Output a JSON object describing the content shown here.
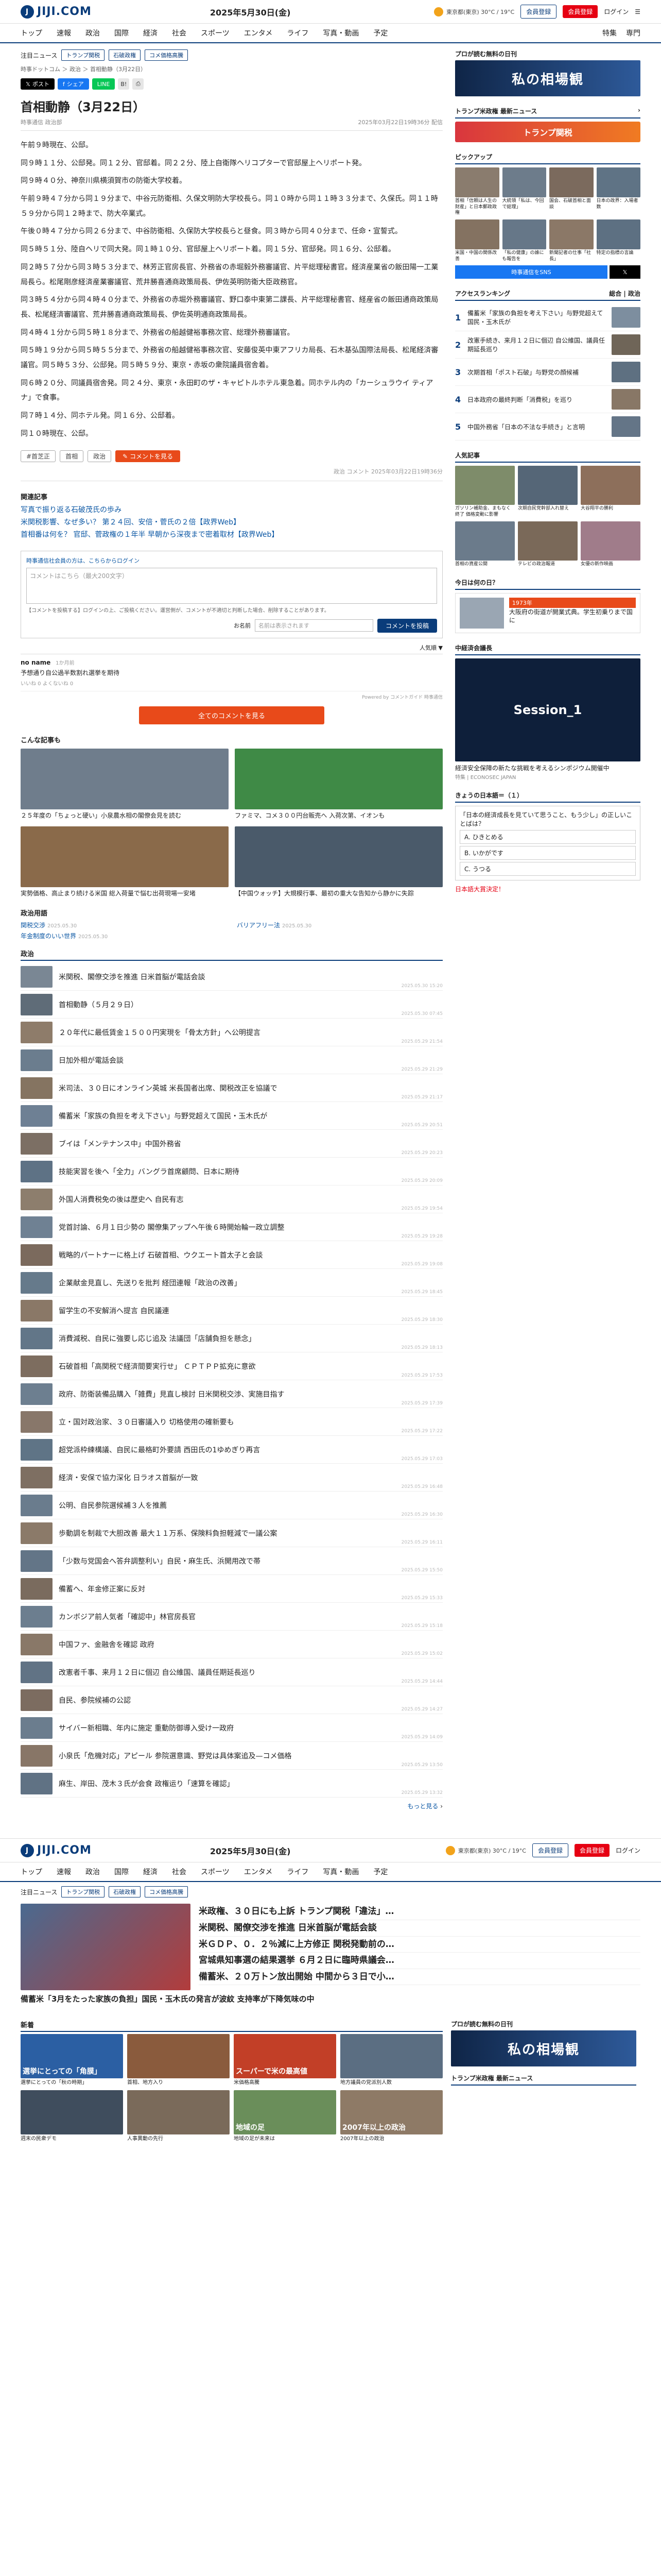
{
  "header": {
    "logo": "JIJI.COM",
    "date": "2025年5月30日(金)",
    "weather_text": "東京都(東京) 30°C / 19°C",
    "free_register": "会員登録",
    "member_register": "会員登録",
    "login": "ログイン",
    "nav": [
      "トップ",
      "速報",
      "政治",
      "国際",
      "経済",
      "社会",
      "スポーツ",
      "エンタメ",
      "ライフ",
      "写真・動画",
      "予定",
      "特集",
      "専門"
    ]
  },
  "breadcrumb": {
    "prefix": "注目ニュース",
    "chips": [
      "トランプ関税",
      "石破政権",
      "コメ価格高騰"
    ],
    "path": "時事ドットコム ＞ 政治 ＞ 首相動静（3月22日）"
  },
  "share": {
    "x": "ポスト",
    "facebook": "シェア",
    "line": "LINE"
  },
  "article": {
    "title": "首相動静（3月22日）",
    "source": "時事通信 政治部",
    "published": "2025年03月22日19時36分 配信",
    "paragraphs": [
      "午前９時現在、公邸。",
      "同９時１１分、公邸発。同１２分、官邸着。同２２分、陸上自衛隊ヘリコプターで官邸屋上ヘリポート発。",
      "同９時４０分、神奈川県横須賀市の防衛大学校着。",
      "午前９時４７分から同１９分まで、中谷元防衛相、久保文明防大学校長ら。同１０時から同１１時３３分まで、久保氏。同１１時５９分から同１２時まで、防大卒業式。",
      "午後０時４７分から同２６分まで、中谷防衛相、久保防大学校長らと昼食。同３時から同４０分まで、任命・宣誓式。",
      "同５時５１分、陸自ヘリで同大発。同１時１０分、官邸屋上ヘリポート着。同１５分、官邸発。同１６分、公邸着。",
      "同２時５７分から同３時５３分まで、林芳正官房長官、外務省の赤堀毅外務審議官、片平総理秘書官。経済産業省の飯田陽一工業局長ら。松尾剛彦経済産業審議官、荒井勝喜通商政策局長、伊佐英明防衛大臣政務官。",
      "同３時５４分から同４時４０分まで、外務省の赤堀外務審議官、野口泰中東第二課長、片平総理秘書官、経産省の飯田通商政策局長、松尾経済審議官、荒井勝喜通商政策局長、伊佐英明通商政策局長。",
      "同４時４１分から同５時１８分まで、外務省の船越健裕事務次官、総理外務審議官。",
      "同５時１９分から同５時５５分まで、外務省の船越健裕事務次官、安藤俊英中東アフリカ局長、石木基弘国際法局長、松尾経済審議官。同５時５３分、公邸発。同５時５９分、東京・赤坂の衆院議員宿舎着。",
      "同６時２０分、同議員宿舎発。同２４分、東京・永田町のザ・キャピトルホテル東急着。同ホテル内の「カーシュラウイ ティアナ」で食事。",
      "同７時１４分、同ホテル発。同１６分、公邸着。",
      "同１０時現在、公邸。"
    ],
    "tags": [
      "#首芝正",
      "首相",
      "政治"
    ],
    "comment_cta": "コメントを見る",
    "footer_time": "政治 コメント 2025年03月22日19時36分"
  },
  "related": {
    "label": "関連記事",
    "links": [
      "写真で振り返る石破茂氏の歩み",
      "米関税影響、なぜ多い？ 第２４回、安倍・菅氏の２倍【政界Web】",
      "首相番は何を？ 官邸、菅政権の１年半 早朝から深夜まで密着取材【政界Web】"
    ]
  },
  "comments": {
    "notice": "時事通信社会員の方は、こちらからログイン",
    "textarea_placeholder": "コメントはこちら（最大200文字）",
    "rules": "【コメントを投稿する】ログインの上、ご投稿ください。運営側が、コメントが不適切と判断した場合、削除することがあります。",
    "name_label": "お名前",
    "name_placeholder": "名前は表示されます",
    "submit": "コメントを投稿",
    "sort": "人気順 ▼",
    "entries": [
      {
        "name": "no name",
        "date": "1か月前",
        "text": "予想通り自公過半数割れ選挙を期待",
        "votes": "いいね 0  よくないね 0"
      }
    ],
    "powered": "Powered by コメントガイド 時事通信",
    "all_button": "全てのコメントを見る"
  },
  "recommend": {
    "label": "こんな記事も",
    "items": [
      {
        "title": "２５年度の「ちょっと硬い」小泉農水相の閣僚会見を読む",
        "color": "#6f7d8c"
      },
      {
        "title": "ファミマ、コメ３００円台販売へ 入荷次第、イオンも",
        "color": "#3f8a46"
      },
      {
        "title": "実勢価格、高止まり続ける米国 総入荷量で悩む出荷現場一安堵",
        "color": "#8a6a4a"
      },
      {
        "title": "【中国ウォッチ】大規模行事、最初の重大な告知から静かに失踪",
        "color": "#4a5a6a"
      }
    ]
  },
  "related_links": {
    "label": "政治用語",
    "items": [
      {
        "text": "関税交渉",
        "date": "2025.05.30"
      },
      {
        "text": "バリアフリー法",
        "date": "2025.05.30"
      },
      {
        "text": "年金制度のいい世界",
        "date": "2025.05.30"
      }
    ]
  },
  "politics_list": {
    "label": "政治",
    "items": [
      {
        "title": "米関税、閣僚交渉を推進 日米首脳が電話会談",
        "date": "2025.05.30 15:20",
        "color": "#7a8794"
      },
      {
        "title": "首相動静（５月２９日）",
        "date": "2025.05.30 07:45",
        "color": "#5f6c78"
      },
      {
        "title": "２０年代に最低賃金１５００円実現を「骨太方針」へ公明提言",
        "date": "2025.05.29 21:54",
        "color": "#8e7c6a"
      },
      {
        "title": "日加外相が電話会談",
        "date": "2025.05.29 21:29",
        "color": "#6b7d8e"
      },
      {
        "title": "米司法、３０日にオンライン英城 米長国者出席、関税改正を協議で",
        "date": "2025.05.29 21:17",
        "color": "#857461"
      },
      {
        "title": "備蓄米「家族の負担を考え下さい」与野党超えて国民・玉木氏が",
        "date": "2025.05.29 20:51",
        "color": "#6e8094"
      },
      {
        "title": "ブイは「メンテナンス中」中国外務省",
        "date": "2025.05.29 20:23",
        "color": "#7c6f64"
      },
      {
        "title": "技能実習を後へ「全力」バングラ首席顧問、日本に期待",
        "date": "2025.05.29 20:09",
        "color": "#5e7285"
      },
      {
        "title": "外国人消費税免の後は歴史へ 自民有志",
        "date": "2025.05.29 19:54",
        "color": "#8d7e6d"
      },
      {
        "title": "党首討論、６月１日少勢の 閣僚集アップへ午後６時開始輪一政立調整",
        "date": "2025.05.29 19:28",
        "color": "#6f8193"
      },
      {
        "title": "戦略的パートナーに格上げ 石破首相、ウクエート首太子と会談",
        "date": "2025.05.29 19:08",
        "color": "#7b6a5d"
      },
      {
        "title": "企業献金見直し、先送りを批判 経団連報「政治の改善」",
        "date": "2025.05.29 18:45",
        "color": "#667a8b"
      },
      {
        "title": "留学生の不安解消へ提言 自民議連",
        "date": "2025.05.29 18:30",
        "color": "#8a7867"
      },
      {
        "title": "消費減税、自民に強要し応じ追及 法議団「店舗負担を懸念」",
        "date": "2025.05.29 18:13",
        "color": "#627688"
      },
      {
        "title": "石破首相「高関税で経済間要実行せ」 ＣＰＴＰＰ拡充に意欲",
        "date": "2025.05.29 17:53",
        "color": "#7d6d5f"
      },
      {
        "title": "政府、防衛装備品購入「雑費」見直し検討 日米関税交渉、実施目指す",
        "date": "2025.05.29 17:39",
        "color": "#6d7f90"
      },
      {
        "title": "立・国対政治家、３０日審議入り 切格使用の確新要も",
        "date": "2025.05.29 17:22",
        "color": "#88776a"
      },
      {
        "title": "超党派枠練構議、自民に最格町外要請 西田氏の1ゆめぎり再言",
        "date": "2025.05.29 17:03",
        "color": "#5f7486"
      },
      {
        "title": "経済・安保で協力深化 日ラオス首脳が一致",
        "date": "2025.05.29 16:48",
        "color": "#7e6f62"
      },
      {
        "title": "公明、自民参院選候補３人を推薦",
        "date": "2025.05.29 16:30",
        "color": "#6a7c8d"
      },
      {
        "title": "歩動調を制裁で大胆改善 最大１１万系、保険料負担軽減で一議公案",
        "date": "2025.05.29 16:11",
        "color": "#8b7a69"
      },
      {
        "title": "「少数与党国会へ答弁調整利い」自民・麻生氏、浜開用改で帯",
        "date": "2025.05.29 15:50",
        "color": "#637587"
      },
      {
        "title": "備蓄へ、年金修正案に反対",
        "date": "2025.05.29 15:33",
        "color": "#7a6b5e"
      },
      {
        "title": "カンボジア前人気者「確認中」林官房長官",
        "date": "2025.05.29 15:18",
        "color": "#6c7e8f"
      },
      {
        "title": "中国ファ、金融舎を確認 政府",
        "date": "2025.05.29 15:02",
        "color": "#897868"
      },
      {
        "title": "改憲者千事、来月１２日に個辺 自公維国、議員任期延長巡り",
        "date": "2025.05.29 14:44",
        "color": "#617385"
      },
      {
        "title": "自民、参院候補の公認",
        "date": "2025.05.29 14:27",
        "color": "#7c6c60"
      },
      {
        "title": "サイバー新相職、年内に施定 重動防御導入受け一政府",
        "date": "2025.05.29 14:09",
        "color": "#6b7d8e"
      },
      {
        "title": "小泉氏「危機対応」アピール 参院選意識、野党は具体案追及—コメ価格",
        "date": "2025.05.29 13:50",
        "color": "#887667"
      },
      {
        "title": "麻生、岸田、茂木３氏が会食 政権运り「速算を確認」",
        "date": "2025.05.29 13:32",
        "color": "#607284"
      }
    ],
    "more": "もっと見る"
  },
  "sidebar": {
    "pr_label": "プロが読む無料の日刊",
    "banner": "私の相場観",
    "trump_head": "トランプ米政権 最新ニュース",
    "trump_promo": "トランプ関税",
    "pickup_head": "ピックアップ",
    "pickup": [
      {
        "txt": "首相「信頼は人生の財産」と日本郵政政権",
        "color": "#8a7c6e"
      },
      {
        "txt": "大統領「私は、今回で総理」",
        "color": "#6d7c8b"
      },
      {
        "txt": "国会、石破首相と面談",
        "color": "#7b6a5d"
      },
      {
        "txt": "日本の政界：入場者数",
        "color": "#5f7385"
      },
      {
        "txt": "米国・中国の関係改善",
        "color": "#847261"
      },
      {
        "txt": "「私の健康」の誰にも報告を",
        "color": "#667788"
      },
      {
        "txt": "新聞記者の仕事「社長」",
        "color": "#8b7867"
      },
      {
        "txt": "特定の指標の言論",
        "color": "#5d7082"
      }
    ],
    "sns_head": "時事通信をSNS",
    "ranking_head": "アクセスランキング",
    "ranking_tabs": [
      "総合",
      "政治"
    ],
    "ranking": [
      {
        "txt": "備蓄米「家族の負担を考え下さい」与野党超えて国民・玉木氏が",
        "color": "#7d8e9f"
      },
      {
        "txt": "改憲手続き、来月１２日に個辺 自公維国、議員任期延長巡り",
        "color": "#6f6558"
      },
      {
        "txt": "次期首相「ポスト石破」与野党の顔候補",
        "color": "#5e7081"
      },
      {
        "txt": "日本政府の最終判断「消費税」を巡り",
        "color": "#887766"
      },
      {
        "txt": "中国外務省「日本の不法な手続き」と言明",
        "color": "#647587"
      }
    ],
    "people_head": "人気記事",
    "people": [
      {
        "txt": "ガソリン補助金、まもなく終了 価格変動に影響",
        "color": "#7e8c6a"
      },
      {
        "txt": "次期自民党幹部入れ替え",
        "color": "#556677"
      },
      {
        "txt": "大谷翔平の勝利",
        "color": "#8d6f5b"
      },
      {
        "txt": "首相の資産公開",
        "color": "#6b7b8b"
      },
      {
        "txt": "テレビの政治報道",
        "color": "#7a6959"
      },
      {
        "txt": "女優の新作映画",
        "color": "#a07c8a"
      }
    ],
    "today_head": "今日は何の日？",
    "today_year": "1973年",
    "today_txt": "大阪府の街道が開業式典。学生初乗りまで国に",
    "ad_head": "中経済会議長",
    "ad_title": "Session_1",
    "ad_caption": "経済安全保障の新たな挑戦を考えるシンポジウム開催中",
    "ad_source": "特集 | ECONOSEC JAPAN",
    "quiz_head": "きょうの日本語＝（１）",
    "quiz_q": "「日本の経済成長を見ていて思うこと、もう少し」の正しいことばは？",
    "quiz_opts": [
      "A. ひきとめる",
      "B. いかがです",
      "C. うつる"
    ],
    "quiz_link": "日本語大賞決定！"
  },
  "bottom": {
    "hero_items": [
      "米政権、３０日にも上訴 トランプ関税「違法」…",
      "米関税、閣僚交渉を推進 日米首脳が電話会談",
      "米ＧＤＰ、０．２％減に上方修正 関税発動前の…",
      "宮城県知事選の結果選挙 ６月２日に臨時県議会…",
      "備蓄米、２０万トン放出開始 中間から３日で小…"
    ],
    "hero_caption": "備蓄米「3月をたった家族の負担」国民・玉木氏の発言が波紋 支持率が下降気味の中",
    "news_head": "新着",
    "news": [
      {
        "txt": "選挙にとっての「秋の時期」",
        "color": "#2b5fa3",
        "overlay": "選挙にとっての「角膜」"
      },
      {
        "txt": "首相、地方入り",
        "color": "#8a5b3d",
        "overlay": ""
      },
      {
        "txt": "米価格高騰",
        "color": "#c23f27",
        "overlay": "スーパーで米の最高値"
      },
      {
        "txt": "地方議員の党派別人数",
        "color": "#5b6e82",
        "overlay": ""
      },
      {
        "txt": "週末の民衆デモ",
        "color": "#3f4d5d",
        "overlay": ""
      },
      {
        "txt": "人事異動の先行",
        "color": "#7a6a5a",
        "overlay": ""
      },
      {
        "txt": "地域の足が未来は",
        "color": "#6a8e5a",
        "overlay": "地域の足"
      },
      {
        "txt": "2007年以上の政治",
        "color": "#8e7a66",
        "overlay": "2007年以上の政治"
      }
    ]
  }
}
